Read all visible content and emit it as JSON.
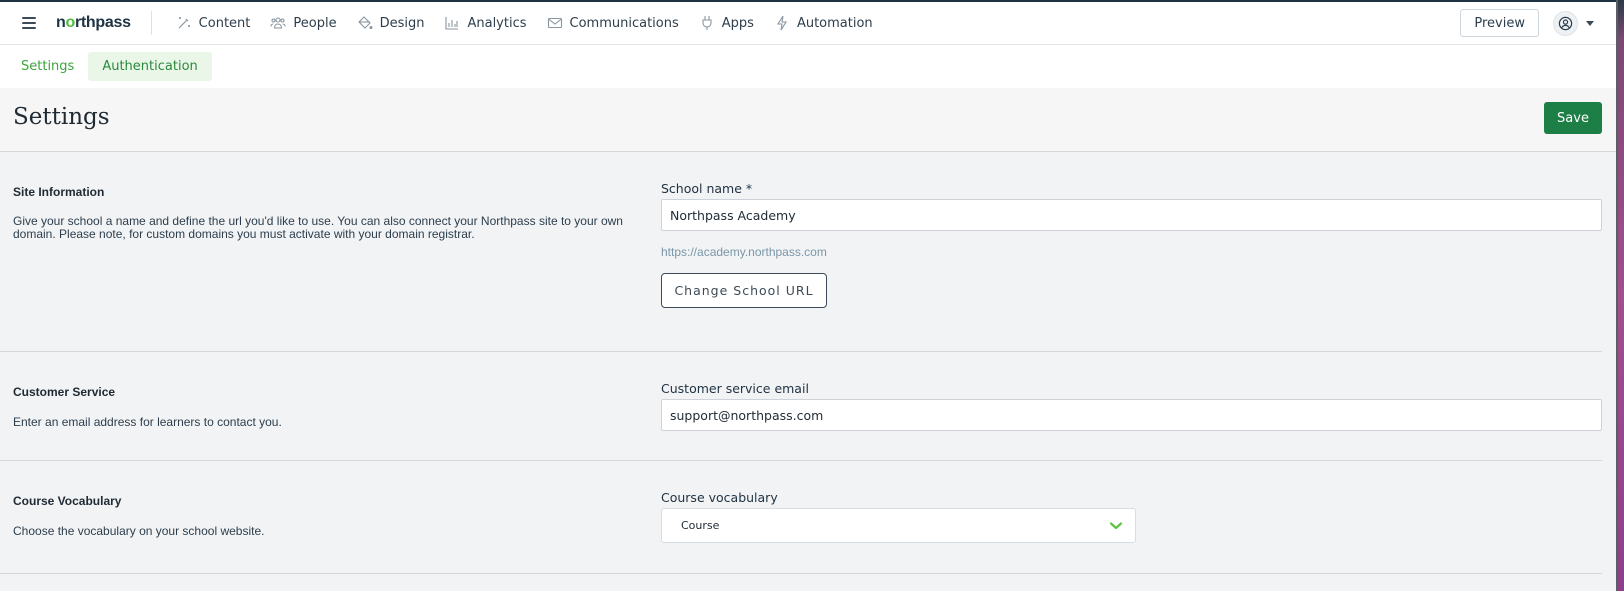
{
  "nav": {
    "brand": {
      "pre": "n",
      "accent": "o",
      "post": "rthpass"
    },
    "items": [
      {
        "label": "Content",
        "icon": "magic-wand-icon"
      },
      {
        "label": "People",
        "icon": "people-icon"
      },
      {
        "label": "Design",
        "icon": "paint-bucket-icon"
      },
      {
        "label": "Analytics",
        "icon": "bar-chart-icon"
      },
      {
        "label": "Communications",
        "icon": "envelope-icon"
      },
      {
        "label": "Apps",
        "icon": "plug-icon"
      },
      {
        "label": "Automation",
        "icon": "lightning-icon"
      }
    ],
    "preview_label": "Preview",
    "account_icon": "user-circle-icon"
  },
  "subtabs": [
    {
      "label": "Settings",
      "active": false
    },
    {
      "label": "Authentication",
      "active": true
    }
  ],
  "page": {
    "title": "Settings",
    "save_label": "Save"
  },
  "sections": {
    "site_info": {
      "title": "Site Information",
      "description": "Give your school a name and define the url you'd like to use. You can also connect your Northpass site to your own domain. Please note, for custom domains you must activate with your domain registrar.",
      "field_label": "School name *",
      "field_value": "Northpass Academy",
      "url_hint": "https://academy.northpass.com",
      "change_url_label": "Change School URL"
    },
    "customer_service": {
      "title": "Customer Service",
      "description": "Enter an email address for learners to contact you.",
      "field_label": "Customer service email",
      "field_value": "support@northpass.com"
    },
    "course_vocabulary": {
      "title": "Course Vocabulary",
      "description": "Choose the vocabulary on your school website.",
      "field_label": "Course vocabulary",
      "selected": "Course"
    }
  },
  "colors": {
    "brand_green": "#1e7f46",
    "tab_green": "#3ba53a",
    "chevron_green": "#5cc53d"
  }
}
